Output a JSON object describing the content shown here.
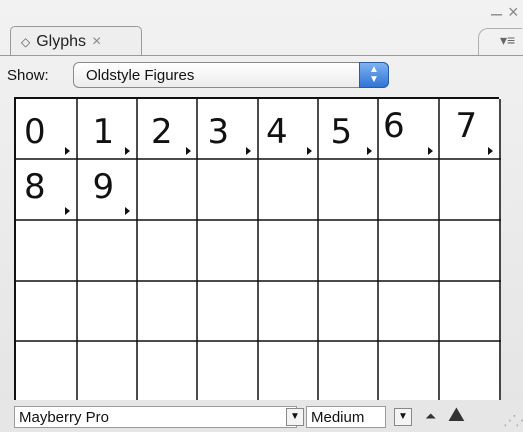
{
  "panel": {
    "tab_title": "Glyphs",
    "tab_icon": "◇",
    "tab_close": "×",
    "window_minimize": "–",
    "window_close": "×",
    "flyout_icon": "▾≡"
  },
  "show": {
    "label": "Show:",
    "selected": "Oldstyle Figures"
  },
  "glyphs": [
    "0",
    "1",
    "2",
    "3",
    "4",
    "5",
    "6",
    "7",
    "8",
    "9"
  ],
  "footer": {
    "font_family": "Mayberry Pro",
    "font_style": "Medium",
    "dropdown_arrow": "▼",
    "zoom_out_icon": "small-mountain-icon",
    "zoom_in_icon": "large-mountain-icon"
  }
}
